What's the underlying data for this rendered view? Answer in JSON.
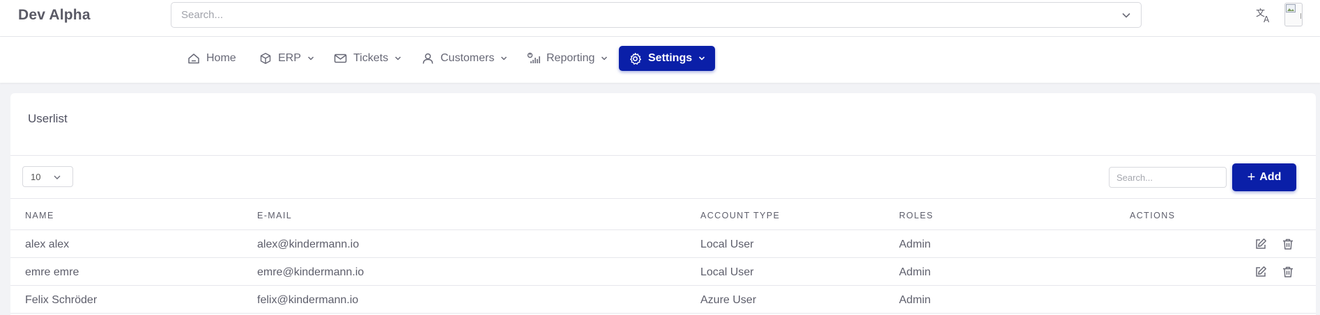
{
  "header": {
    "brand": "Dev Alpha",
    "search_placeholder": "Search..."
  },
  "nav": {
    "items": [
      {
        "label": "Home",
        "icon": "home-icon",
        "has_dropdown": false
      },
      {
        "label": "ERP",
        "icon": "cube-icon",
        "has_dropdown": true
      },
      {
        "label": "Tickets",
        "icon": "mail-icon",
        "has_dropdown": true
      },
      {
        "label": "Customers",
        "icon": "user-icon",
        "has_dropdown": true
      },
      {
        "label": "Reporting",
        "icon": "chart-icon",
        "has_dropdown": true
      },
      {
        "label": "Settings",
        "icon": "gear-icon",
        "has_dropdown": true,
        "active": true
      }
    ]
  },
  "userlist": {
    "title": "Userlist",
    "page_size": "10",
    "search_placeholder": "Search...",
    "add_label": "Add",
    "columns": [
      "NAME",
      "E-MAIL",
      "ACCOUNT TYPE",
      "ROLES",
      "ACTIONS"
    ],
    "rows": [
      {
        "name": "alex alex",
        "email": "alex@kindermann.io",
        "account_type": "Local User",
        "roles": "Admin",
        "actions": [
          "edit-icon",
          "trash-icon"
        ]
      },
      {
        "name": "emre emre",
        "email": "emre@kindermann.io",
        "account_type": "Local User",
        "roles": "Admin",
        "actions": [
          "edit-icon",
          "trash-icon"
        ]
      },
      {
        "name": "Felix Schröder",
        "email": "felix@kindermann.io",
        "account_type": "Azure User",
        "roles": "Admin",
        "actions": []
      }
    ]
  },
  "colors": {
    "accent": "#0a1fa8",
    "background": "#f2f3f6",
    "text": "#5d5e6b"
  }
}
